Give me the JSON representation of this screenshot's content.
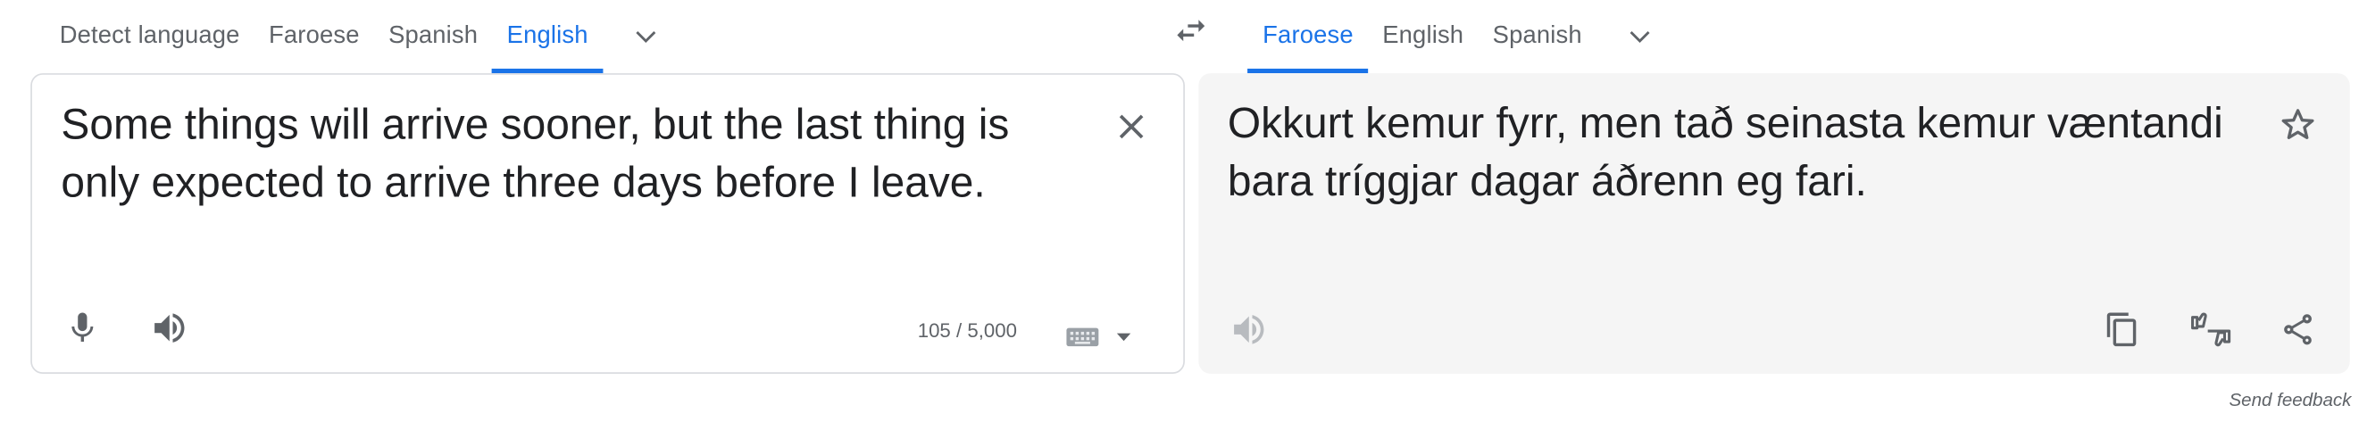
{
  "source_tabs": [
    "Detect language",
    "Faroese",
    "Spanish",
    "English"
  ],
  "target_tabs": [
    "Faroese",
    "English",
    "Spanish"
  ],
  "source_text": "Some things will arrive sooner, but the last thing is only expected to arrive three days before I leave.",
  "translated_text": "Okkurt kemur fyrr, men tað seinasta kemur væntandi bara tríggjar dagar áðrenn eg fari.",
  "char_count": "105 / 5,000",
  "send_feedback": "Send feedback",
  "colors": {
    "accent": "#1a73e8",
    "icon": "#5f6368",
    "icon_disabled": "#b8bbbf",
    "target_panel_bg": "#f5f5f5",
    "border": "#dadce0"
  },
  "icons": [
    "chevron-down-icon",
    "swap-arrows-icon",
    "clear-icon",
    "microphone-icon",
    "speaker-icon",
    "keyboard-icon",
    "star-icon",
    "copy-icon",
    "thumbs-feedback-icon",
    "share-icon"
  ]
}
